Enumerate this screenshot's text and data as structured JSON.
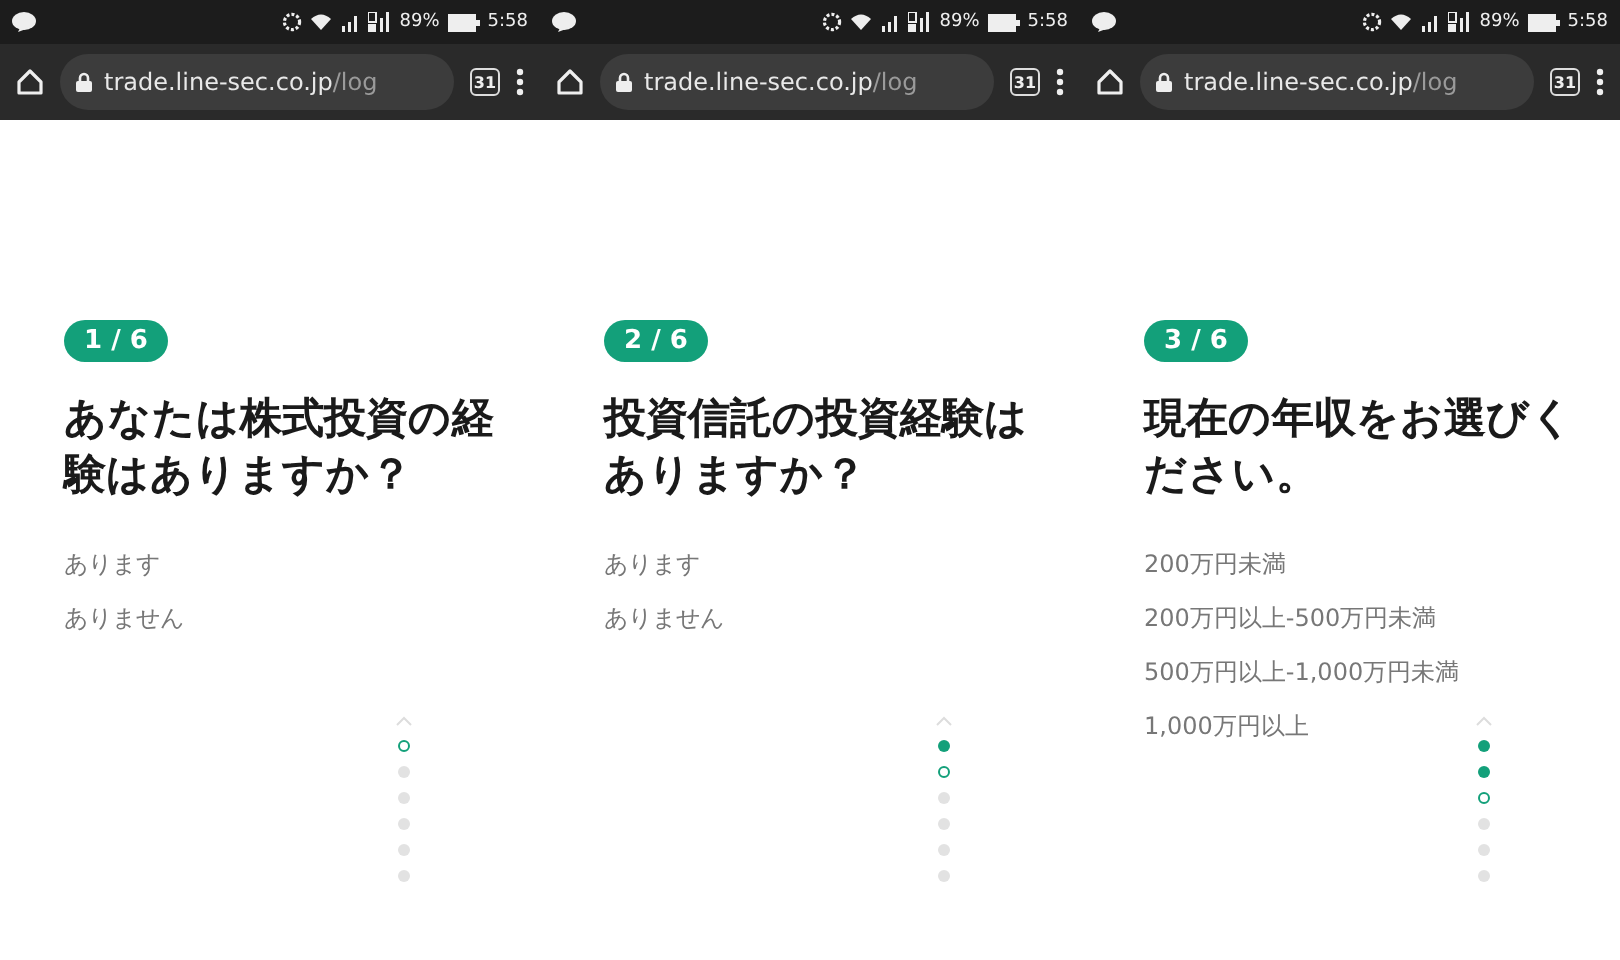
{
  "screens": [
    {
      "status_bar": {
        "battery": "89%",
        "time": "5:58"
      },
      "browser": {
        "url_host": "trade.line-sec.co.jp",
        "url_path": "/log",
        "tab_count": "31"
      },
      "question": {
        "step": "1 / 6",
        "title": "あなたは株式投資の経験はありますか？",
        "options": [
          "あります",
          "ありません"
        ]
      },
      "progress": [
        {
          "completed": false,
          "selected": true
        },
        {
          "completed": false,
          "selected": false
        },
        {
          "completed": false,
          "selected": false
        },
        {
          "completed": false,
          "selected": false
        },
        {
          "completed": false,
          "selected": false
        },
        {
          "completed": false,
          "selected": false
        }
      ]
    },
    {
      "status_bar": {
        "battery": "89%",
        "time": "5:58"
      },
      "browser": {
        "url_host": "trade.line-sec.co.jp",
        "url_path": "/log",
        "tab_count": "31"
      },
      "question": {
        "step": "2 / 6",
        "title": "投資信託の投資経験はありますか？",
        "options": [
          "あります",
          "ありません"
        ]
      },
      "progress": [
        {
          "completed": true,
          "selected": false
        },
        {
          "completed": false,
          "selected": true
        },
        {
          "completed": false,
          "selected": false
        },
        {
          "completed": false,
          "selected": false
        },
        {
          "completed": false,
          "selected": false
        },
        {
          "completed": false,
          "selected": false
        }
      ]
    },
    {
      "status_bar": {
        "battery": "89%",
        "time": "5:58"
      },
      "browser": {
        "url_host": "trade.line-sec.co.jp",
        "url_path": "/log",
        "tab_count": "31"
      },
      "question": {
        "step": "3 / 6",
        "title": "現在の年収をお選びください。",
        "options": [
          "200万円未満",
          "200万円以上-500万円未満",
          "500万円以上-1,000万円未満",
          "1,000万円以上"
        ]
      },
      "progress": [
        {
          "completed": true,
          "selected": false
        },
        {
          "completed": true,
          "selected": false
        },
        {
          "completed": false,
          "selected": true
        },
        {
          "completed": false,
          "selected": false
        },
        {
          "completed": false,
          "selected": false
        },
        {
          "completed": false,
          "selected": false
        }
      ]
    }
  ]
}
